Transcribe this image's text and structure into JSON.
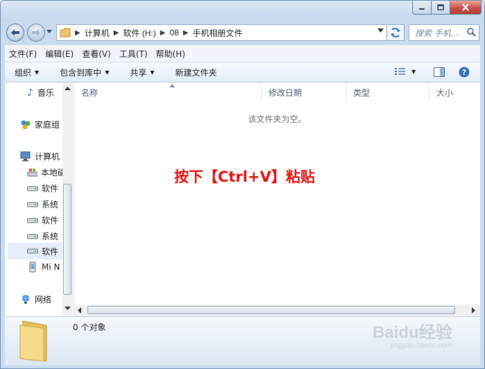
{
  "breadcrumb": [
    "计算机",
    "软件 (H:)",
    "08",
    "手机相册文件"
  ],
  "search": {
    "placeholder": "搜索 手机..."
  },
  "menu": [
    "文件(F)",
    "编辑(E)",
    "查看(V)",
    "工具(T)",
    "帮助(H)"
  ],
  "commands": {
    "organize": "组织",
    "include_library": "包含到库中",
    "share": "共享",
    "new_folder": "新建文件夹"
  },
  "nav_items": [
    {
      "label": "音乐",
      "icon": "music-icon"
    },
    {
      "label": "家庭组",
      "icon": "homegroup-icon"
    },
    {
      "label": "计算机",
      "icon": "computer-icon"
    },
    {
      "label": "本地磁",
      "icon": "local-disk-icon"
    },
    {
      "label": "软件",
      "icon": "drive-icon"
    },
    {
      "label": "系统",
      "icon": "drive-icon"
    },
    {
      "label": "软件",
      "icon": "drive-icon"
    },
    {
      "label": "系统",
      "icon": "drive-icon"
    },
    {
      "label": "软件",
      "icon": "drive-icon"
    },
    {
      "label": "Mi N",
      "icon": "phone-icon"
    },
    {
      "label": "网络",
      "icon": "network-icon"
    }
  ],
  "columns": [
    "名称",
    "修改日期",
    "类型",
    "大小"
  ],
  "empty_message": "该文件夹为空。",
  "overlay_text": "按下【Ctrl+V】粘贴",
  "status": "0 个对象",
  "watermark": {
    "brand": "Baidu经验",
    "url": "jingyan.baidu.com"
  },
  "colors": {
    "overlay": "#e01010",
    "close_button": "#c75050"
  }
}
